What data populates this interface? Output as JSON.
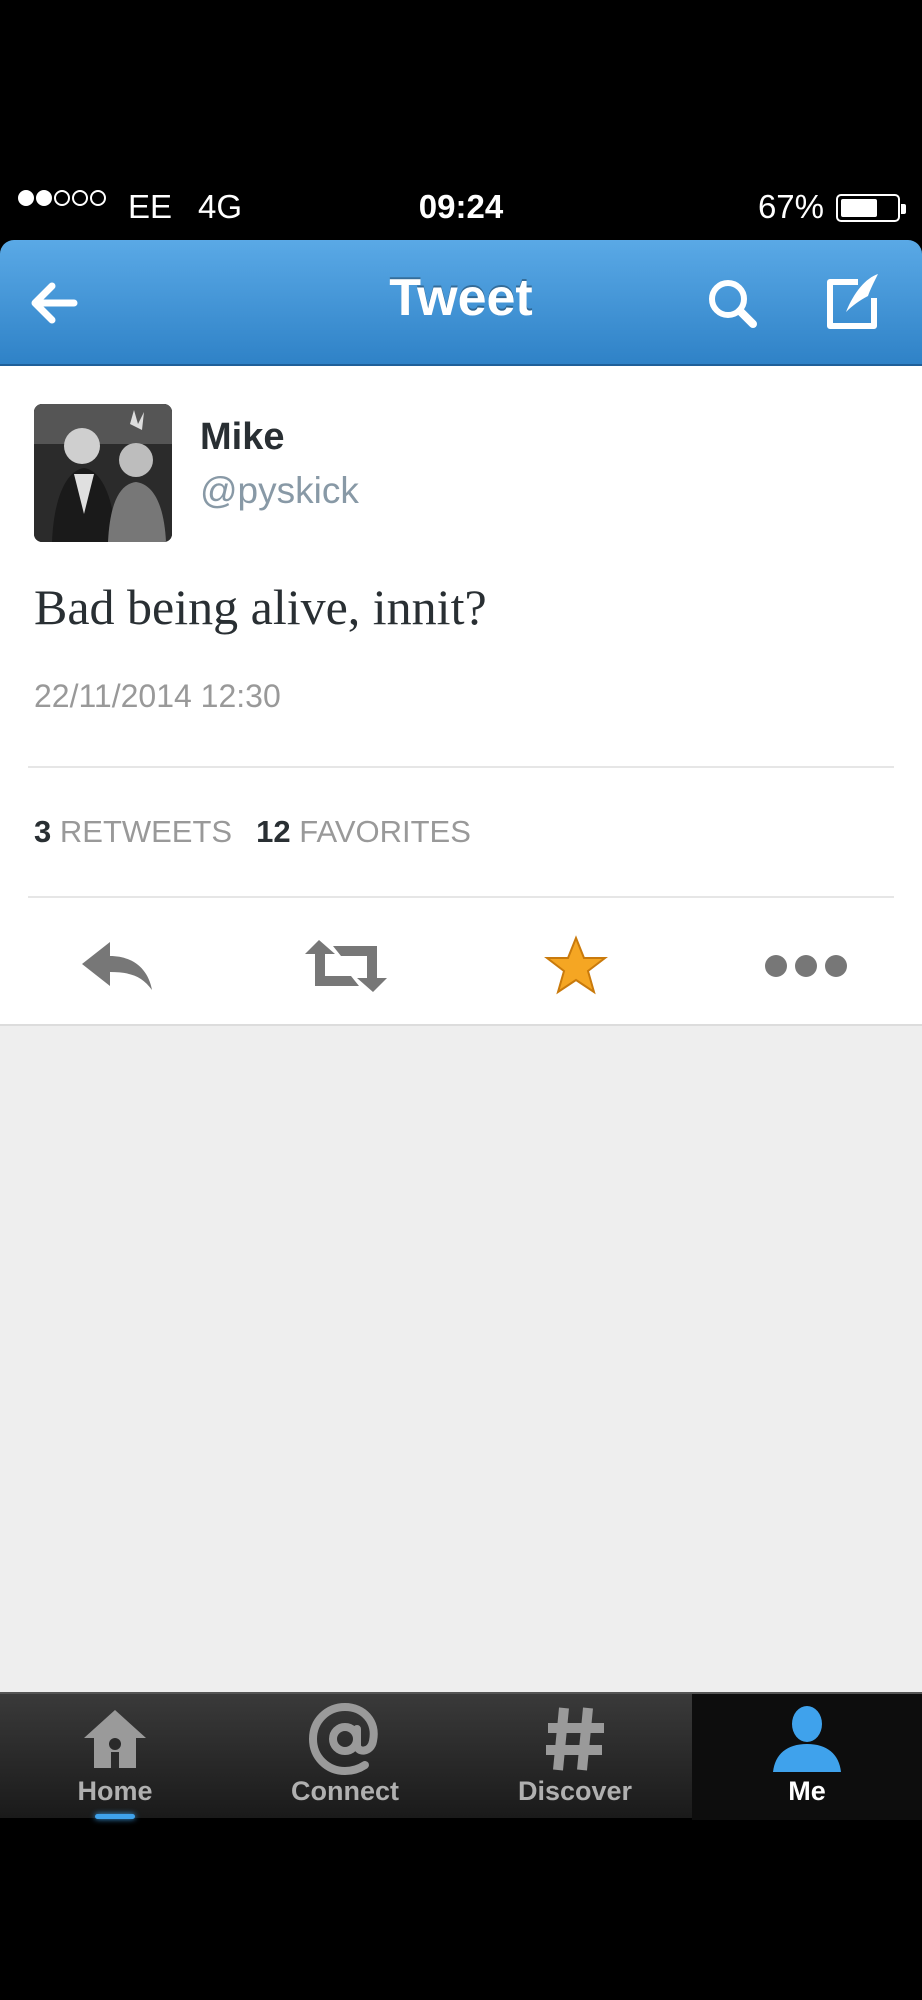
{
  "status": {
    "signal_bars_filled": 2,
    "signal_bars_total": 5,
    "carrier": "EE",
    "network": "4G",
    "time": "09:24",
    "battery_percent": "67%",
    "battery_level": 0.67
  },
  "nav": {
    "title": "Tweet",
    "back_icon": "arrow-left-icon",
    "search_icon": "search-icon",
    "compose_icon": "compose-icon"
  },
  "tweet": {
    "author_name": "Mike",
    "author_handle": "@pyskick",
    "text": "Bad being alive, innit?",
    "date": "22/11/2014 12:30",
    "retweet_count": "3",
    "retweet_label": "RETWEETS",
    "favorite_count": "12",
    "favorite_label": "FAVORITES"
  },
  "actions": [
    {
      "name": "reply",
      "icon": "reply-icon"
    },
    {
      "name": "retweet",
      "icon": "retweet-icon"
    },
    {
      "name": "favorite",
      "icon": "star-icon",
      "color": "#f5a623"
    },
    {
      "name": "more",
      "icon": "more-icon"
    }
  ],
  "tabs": [
    {
      "label": "Home",
      "icon": "home-icon"
    },
    {
      "label": "Connect",
      "icon": "at-icon"
    },
    {
      "label": "Discover",
      "icon": "hashtag-icon"
    },
    {
      "label": "Me",
      "icon": "person-icon",
      "active": true
    }
  ],
  "colors": {
    "nav_blue": "#2f82c7",
    "favorite_orange": "#f5a623",
    "active_tab_icon": "#3fa2ec"
  }
}
